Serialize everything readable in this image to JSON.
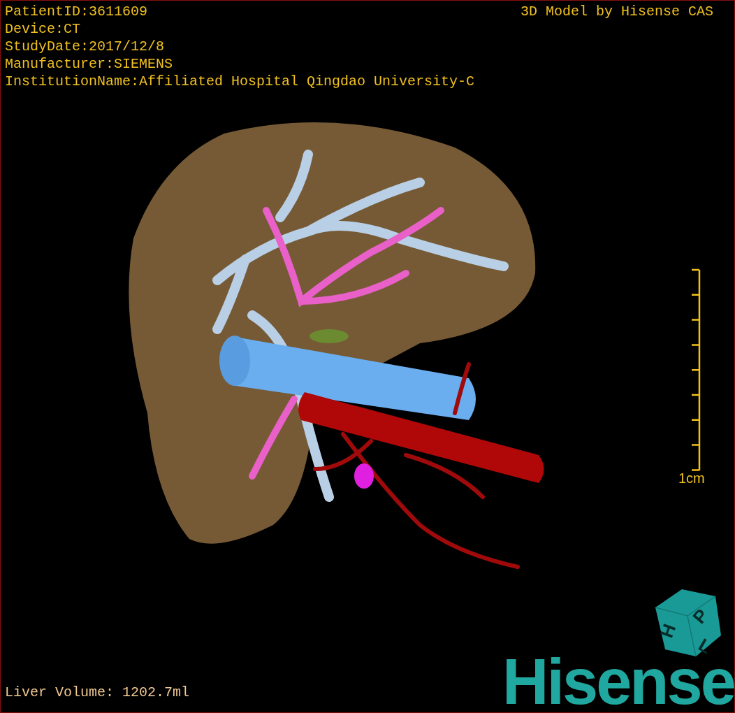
{
  "info_lines": [
    "PatientID:3611609",
    "Device:CT",
    "StudyDate:2017/12/8",
    "Manufacturer:SIEMENS",
    "InstitutionName:Affiliated Hospital Qingdao University-C"
  ],
  "credit": "3D Model by Hisense CAS",
  "scale_bar": {
    "label": "1cm"
  },
  "volume": "Liver Volume: 1202.7ml",
  "logo": {
    "cube_letters": [
      "H",
      "P",
      "L"
    ],
    "brand": "Hisense"
  }
}
